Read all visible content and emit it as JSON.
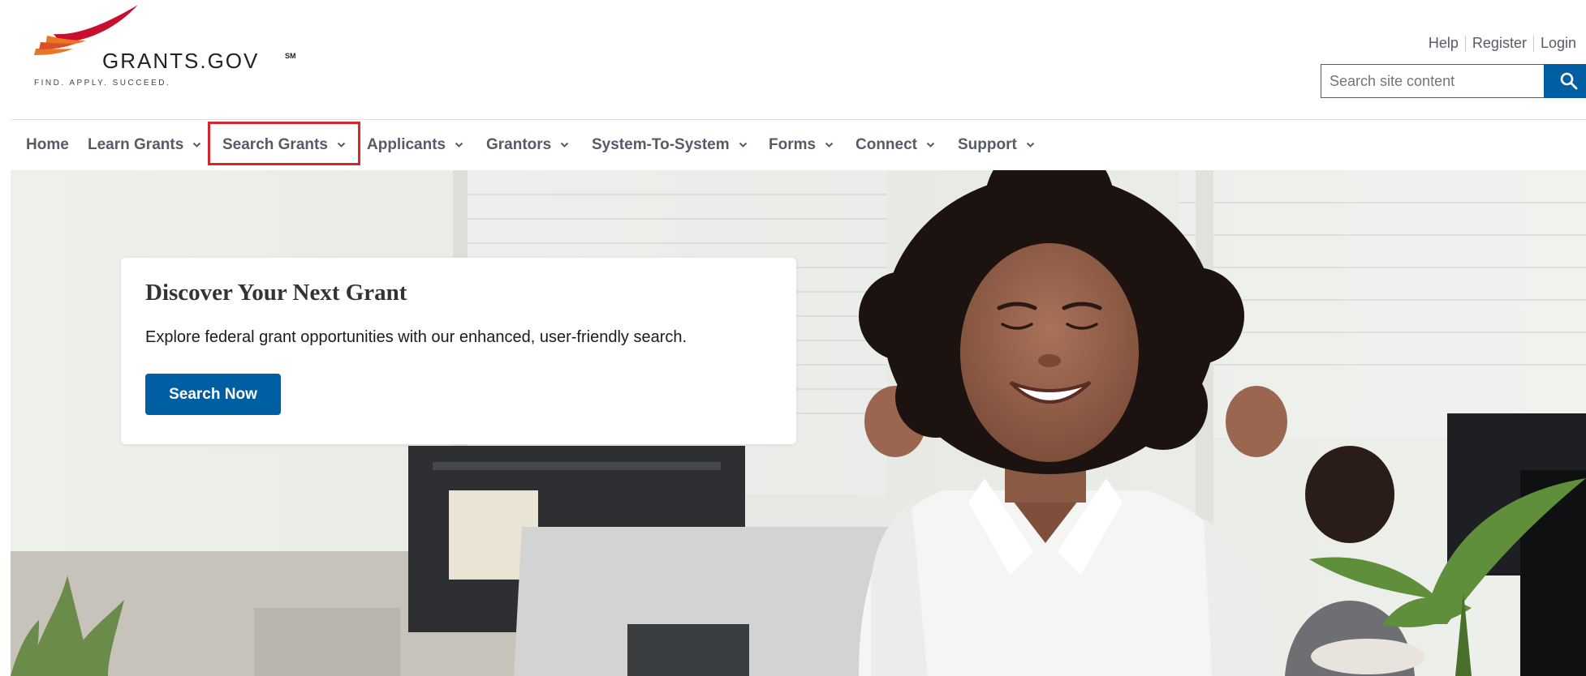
{
  "logo": {
    "wordmark": "GRANTS.GOV",
    "service_mark": "SM",
    "tagline": "FIND. APPLY. SUCCEED."
  },
  "utility_links": [
    "Help",
    "Register",
    "Login"
  ],
  "search": {
    "placeholder": "Search site content",
    "button_icon": "search-icon"
  },
  "nav": {
    "items": [
      {
        "label": "Home",
        "has_dropdown": false
      },
      {
        "label": "Learn Grants",
        "has_dropdown": true
      },
      {
        "label": "Search Grants",
        "has_dropdown": true
      },
      {
        "label": "Applicants",
        "has_dropdown": true
      },
      {
        "label": "Grantors",
        "has_dropdown": true
      },
      {
        "label": "System-To-System",
        "has_dropdown": true
      },
      {
        "label": "Forms",
        "has_dropdown": true
      },
      {
        "label": "Connect",
        "has_dropdown": true
      },
      {
        "label": "Support",
        "has_dropdown": true
      }
    ],
    "highlighted_item": "Search Grants"
  },
  "hero": {
    "title": "Discover Your Next Grant",
    "text": "Explore federal grant opportunities with our enhanced, user-friendly search.",
    "button_label": "Search Now",
    "image": "woman-celebrating-at-laptop-photo"
  },
  "colors": {
    "primary": "#005ea2",
    "nav_text": "#565c65",
    "highlight": "#d8252d",
    "logo_red": "#c8102e",
    "logo_orange": "#e87722"
  }
}
